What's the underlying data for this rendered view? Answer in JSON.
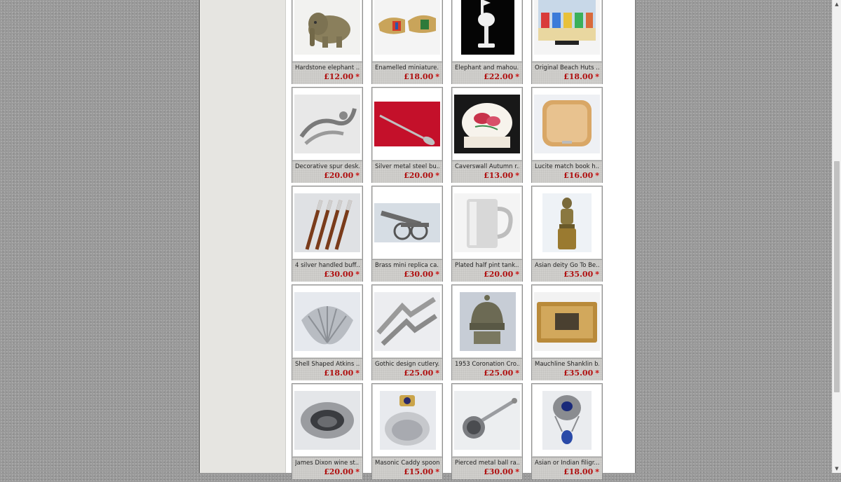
{
  "products": [
    [
      {
        "title": "Hardstone elephant ...",
        "price": "£12.00",
        "star": "*",
        "icon": "hardstone-elephant-image"
      },
      {
        "title": "Enamelled miniature...",
        "price": "£18.00",
        "star": "*",
        "icon": "enamelled-clogs-image"
      },
      {
        "title": "Elephant and mahou...",
        "price": "£22.00",
        "star": "*",
        "icon": "elephant-mahout-chess-image"
      },
      {
        "title": "Original Beach Huts ...",
        "price": "£18.00",
        "star": "*",
        "icon": "beach-huts-painting-image"
      }
    ],
    [
      {
        "title": "Decorative spur desk...",
        "price": "£20.00",
        "star": "*",
        "icon": "spur-desk-ornament-image"
      },
      {
        "title": "Silver metal steel bu...",
        "price": "£20.00",
        "star": "*",
        "icon": "silver-buttonhook-image"
      },
      {
        "title": "Caverswall Autumn r...",
        "price": "£13.00",
        "star": "*",
        "icon": "caverswall-trinket-box-image"
      },
      {
        "title": "Lucite match book h...",
        "price": "£16.00",
        "star": "*",
        "icon": "lucite-matchbook-holder-image"
      }
    ],
    [
      {
        "title": "4 silver handled buff...",
        "price": "£30.00",
        "star": "*",
        "icon": "silver-handled-knives-image"
      },
      {
        "title": "Brass mini replica ca...",
        "price": "£30.00",
        "star": "*",
        "icon": "brass-cannon-image"
      },
      {
        "title": "Plated half pint tank...",
        "price": "£20.00",
        "star": "*",
        "icon": "plated-tankard-image"
      },
      {
        "title": "Asian deity Go To Be...",
        "price": "£35.00",
        "star": "*",
        "icon": "asian-deity-figure-image"
      }
    ],
    [
      {
        "title": "Shell Shaped Atkins ...",
        "price": "£18.00",
        "star": "*",
        "icon": "shell-dish-image"
      },
      {
        "title": "Gothic design cutlery...",
        "price": "£25.00",
        "star": "*",
        "icon": "gothic-cutlery-rests-image"
      },
      {
        "title": "1953 Coronation Cro...",
        "price": "£25.00",
        "star": "*",
        "icon": "coronation-crown-image"
      },
      {
        "title": "Mauchline Shanklin b...",
        "price": "£35.00",
        "star": "*",
        "icon": "mauchline-box-image"
      }
    ],
    [
      {
        "title": "James Dixon wine st...",
        "price": "£20.00",
        "star": "*",
        "icon": "wine-strainer-image"
      },
      {
        "title": "Masonic Caddy spoon",
        "price": "£15.00",
        "star": "*",
        "icon": "masonic-caddy-spoon-image"
      },
      {
        "title": "Pierced metal ball ra...",
        "price": "£30.00",
        "star": "*",
        "icon": "pierced-ball-rattle-image"
      },
      {
        "title": "Asian or Indian filigr...",
        "price": "£18.00",
        "star": "*",
        "icon": "filigree-pendant-image"
      }
    ]
  ],
  "scrollbar": {
    "up": "▲",
    "down": "▼"
  },
  "colors": {
    "price": "#b01010",
    "card_bg": "#d0cfcc",
    "sidebar_bg": "#e6e5e1",
    "page_bg": "#9a9a9a"
  }
}
